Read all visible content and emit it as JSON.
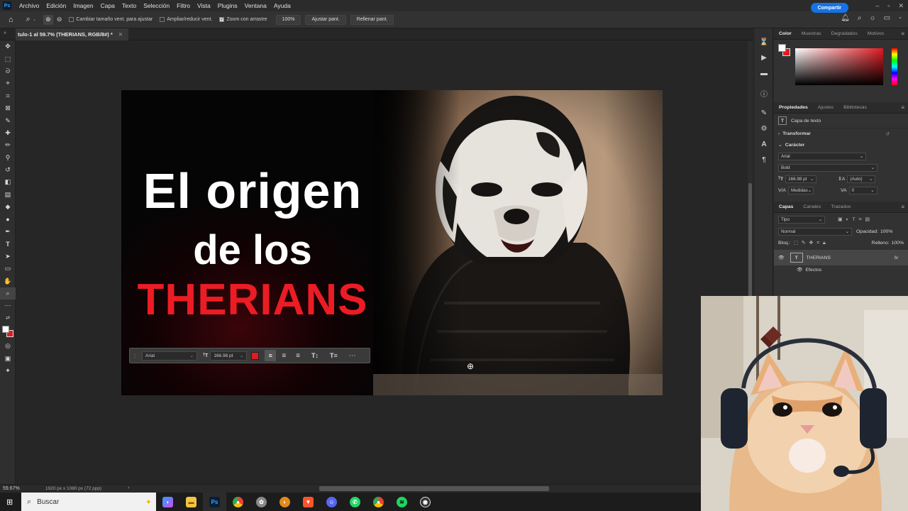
{
  "menu": {
    "app_icon": "Ps",
    "items": [
      "Archivo",
      "Edición",
      "Imagen",
      "Capa",
      "Texto",
      "Selección",
      "Filtro",
      "Vista",
      "Plugins",
      "Ventana",
      "Ayuda"
    ]
  },
  "options_bar": {
    "resize_windows": "Cambiar tamaño vent. para ajustar",
    "zoom_all_windows": "Ampliar/reducir vent.",
    "scrubby_zoom": "Zoom con arrastre",
    "zoom_100": "100%",
    "fit_screen": "Ajustar pant.",
    "fill_screen": "Rellenar pant.",
    "share": "Compartir"
  },
  "document_tab": {
    "title": "tulo-1 al 59.7% (THERIANS, RGB/8#) *"
  },
  "canvas": {
    "line1": "El origen",
    "line2": "de los",
    "line3": "THERIANS",
    "accent_color": "#ec1c24"
  },
  "text_bar": {
    "font": "Arial",
    "size": "166.98 pt",
    "color": "#e01b22"
  },
  "panels": {
    "color_tabs": [
      "Color",
      "Muestras",
      "Degradados",
      "Motivos"
    ],
    "props_tabs": [
      "Propiedades",
      "Ajustes",
      "Bibliotecas"
    ],
    "layer_kind": "Capa de texto",
    "transform": "Transformar",
    "character": "Carácter",
    "font_family": "Arial",
    "font_style": "Bold",
    "font_size": "166.98 pt",
    "leading": "(Auto)",
    "kerning": "Medidas",
    "tracking": "0",
    "layers_tabs": [
      "Capas",
      "Canales",
      "Trazados"
    ],
    "filter": "Tipo",
    "blend_mode": "Normal",
    "opacity_label": "Opacidad:",
    "opacity": "100%",
    "lock_label": "Bloq.:",
    "fill_label": "Relleno:",
    "fill": "100%",
    "layer_name": "THERIANS",
    "effects": "Efectos"
  },
  "status": {
    "zoom": "59.67%",
    "doc_info": "1920 px x 1080 px (72 ppp)"
  },
  "taskbar": {
    "search_placeholder": "Buscar"
  }
}
